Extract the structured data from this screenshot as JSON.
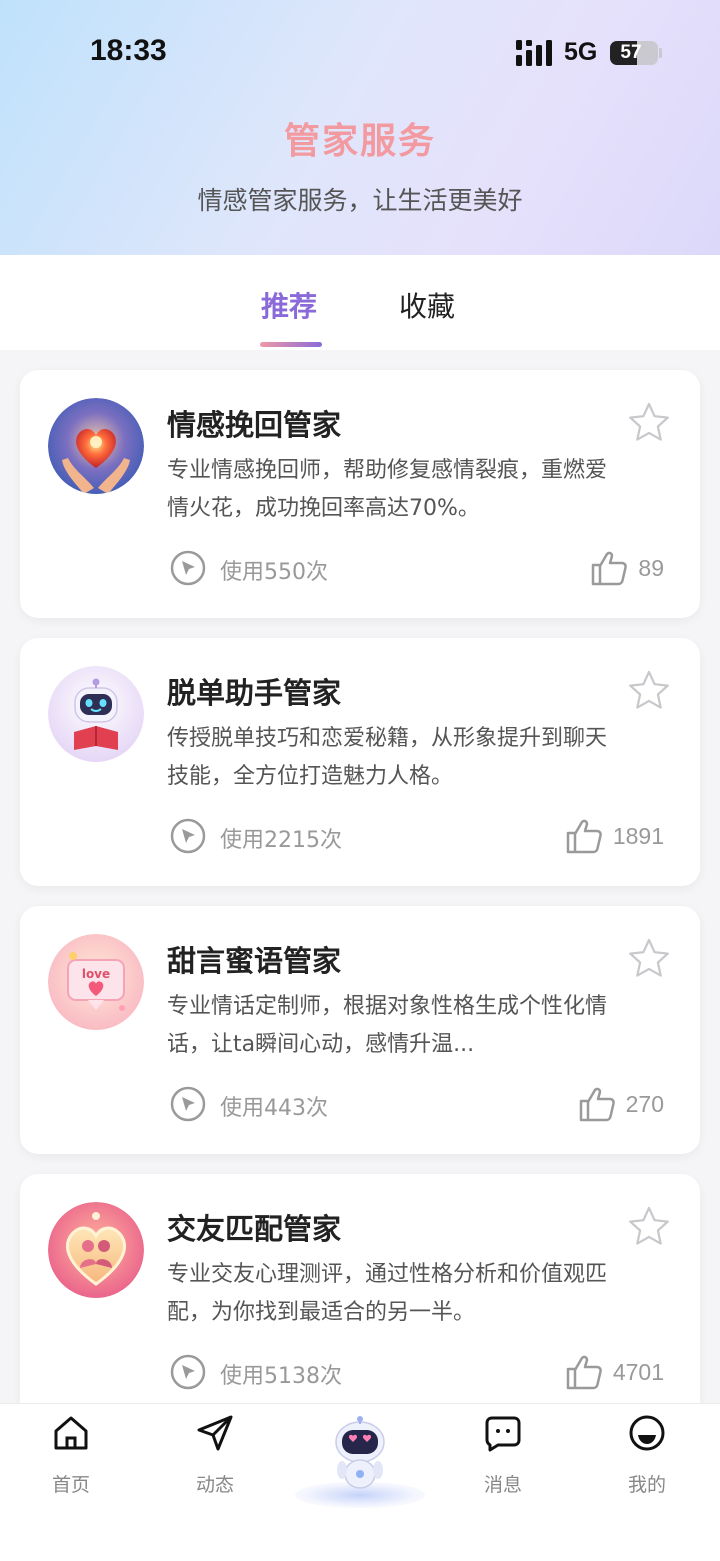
{
  "status_bar": {
    "time": "18:33",
    "network": "5G",
    "battery": "57",
    "battery_level": 0.57
  },
  "header": {
    "title": "管家服务",
    "subtitle": "情感管家服务，让生活更美好"
  },
  "tabs": [
    {
      "label": "推荐",
      "active": true
    },
    {
      "label": "收藏",
      "active": false
    }
  ],
  "cards": [
    {
      "title": "情感挽回管家",
      "description": "专业情感挽回师，帮助修复感情裂痕，重燃爱情火花，成功挽回率高达70%。",
      "usage": "使用550次",
      "likes": "89",
      "avatar_icon": "heart-in-hands-icon"
    },
    {
      "title": "脱单助手管家",
      "description": "传授脱单技巧和恋爱秘籍，从形象提升到聊天技能，全方位打造魅力人格。",
      "usage": "使用2215次",
      "likes": "1891",
      "avatar_icon": "robot-reading-icon"
    },
    {
      "title": "甜言蜜语管家",
      "description": "专业情话定制师，根据对象性格生成个性化情话，让ta瞬间心动，感情升温...",
      "usage": "使用443次",
      "likes": "270",
      "avatar_icon": "love-message-icon"
    },
    {
      "title": "交友匹配管家",
      "description": "专业交友心理测评，通过性格分析和价值观匹配，为你找到最适合的另一半。",
      "usage": "使用5138次",
      "likes": "4701",
      "avatar_icon": "couple-heart-icon"
    }
  ],
  "bottom_nav": [
    {
      "label": "首页",
      "icon": "home-icon"
    },
    {
      "label": "动态",
      "icon": "send-icon"
    },
    {
      "label": "",
      "icon": "robot-icon"
    },
    {
      "label": "消息",
      "icon": "message-icon"
    },
    {
      "label": "我的",
      "icon": "profile-icon"
    }
  ],
  "colors": {
    "title_pink": "#f39aa0",
    "tab_active": "#8a6ad8",
    "muted": "#999999"
  }
}
